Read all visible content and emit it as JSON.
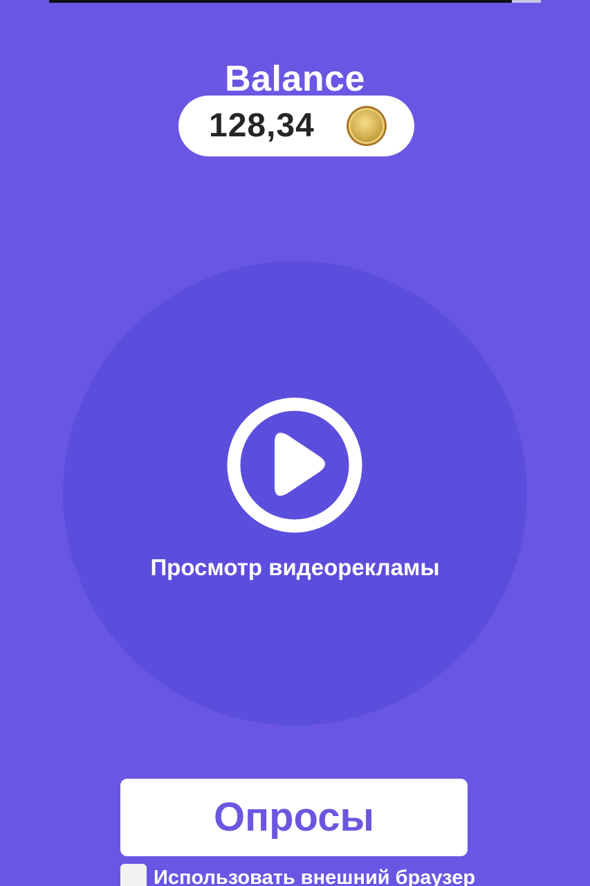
{
  "balance": {
    "title": "Balance",
    "amount": "128,34",
    "currency_icon": "gold-coin-icon"
  },
  "ad": {
    "icon": "play-icon",
    "label": "Просмотр видеорекламы"
  },
  "surveys": {
    "button_label": "Опросы"
  },
  "external_browser": {
    "label": "Использовать внешний браузер",
    "checked": false
  },
  "colors": {
    "background": "#6957e3",
    "circle": "#5c4edd",
    "accent_text": "#6a57e0",
    "coin": "#c9a547"
  }
}
